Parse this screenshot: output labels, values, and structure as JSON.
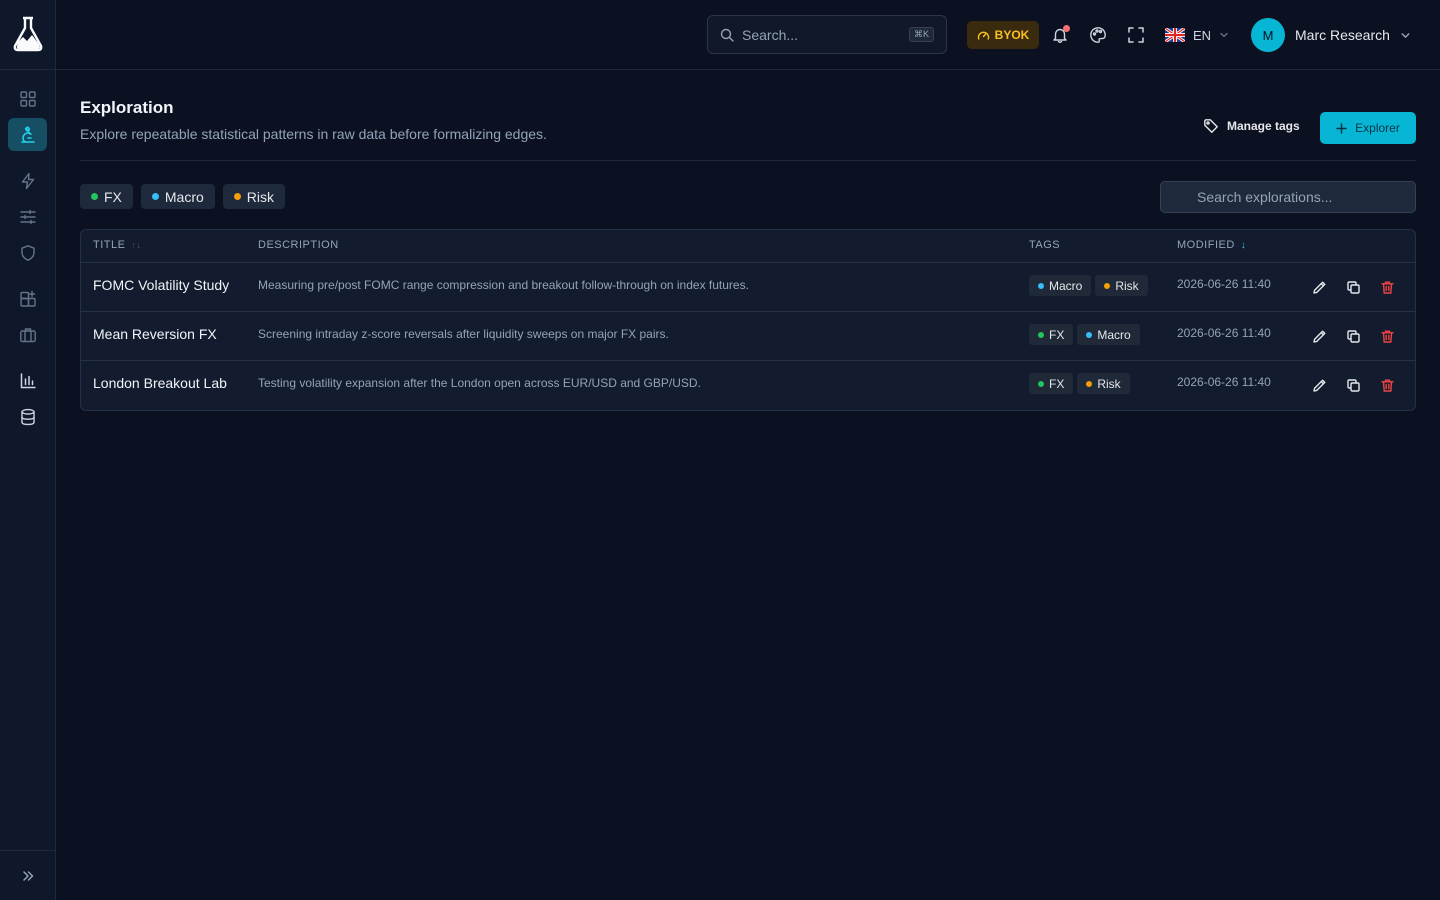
{
  "topbar": {
    "search_placeholder": "Search...",
    "search_shortcut": "⌘K",
    "byok_label": "BYOK",
    "language": "EN",
    "user": {
      "initial": "M",
      "name": "Marc Research"
    }
  },
  "sidebar": {
    "items": [
      {
        "icon": "dashboard-icon",
        "active": false
      },
      {
        "icon": "microscope-icon",
        "active": true
      },
      {
        "icon": "lightning-icon",
        "active": false
      },
      {
        "icon": "sliders-icon",
        "active": false
      },
      {
        "icon": "shield-icon",
        "active": false
      },
      {
        "icon": "apps-add-icon",
        "active": false
      },
      {
        "icon": "briefcase-icon",
        "active": false
      },
      {
        "icon": "bar-chart-icon",
        "active": false
      },
      {
        "icon": "database-icon",
        "active": false
      }
    ]
  },
  "page": {
    "title": "Exploration",
    "subtitle": "Explore repeatable statistical patterns in raw data before formalizing edges.",
    "manage_tags_label": "Manage tags",
    "explorer_button_label": "Explorer",
    "search_explorations_placeholder": "Search explorations..."
  },
  "colors": {
    "accent": "#06b6d4",
    "fx": "#22c55e",
    "macro": "#38bdf8",
    "risk": "#f59e0b",
    "delete": "#ef4444"
  },
  "filters": [
    {
      "label": "FX",
      "color": "#22c55e"
    },
    {
      "label": "Macro",
      "color": "#38bdf8"
    },
    {
      "label": "Risk",
      "color": "#f59e0b"
    }
  ],
  "table": {
    "columns": {
      "title": "TITLE",
      "title_sort": "↑↓",
      "description": "DESCRIPTION",
      "tags": "TAGS",
      "modified": "MODIFIED",
      "modified_sort": "↓"
    },
    "rows": [
      {
        "title": "FOMC Volatility Study",
        "description": "Measuring pre/post FOMC range compression and breakout follow-through on index futures.",
        "tags": [
          {
            "label": "Macro",
            "color": "#38bdf8"
          },
          {
            "label": "Risk",
            "color": "#f59e0b"
          }
        ],
        "modified": "2026-06-26 11:40"
      },
      {
        "title": "Mean Reversion FX",
        "description": "Screening intraday z-score reversals after liquidity sweeps on major FX pairs.",
        "tags": [
          {
            "label": "FX",
            "color": "#22c55e"
          },
          {
            "label": "Macro",
            "color": "#38bdf8"
          }
        ],
        "modified": "2026-06-26 11:40"
      },
      {
        "title": "London Breakout Lab",
        "description": "Testing volatility expansion after the London open across EUR/USD and GBP/USD.",
        "tags": [
          {
            "label": "FX",
            "color": "#22c55e"
          },
          {
            "label": "Risk",
            "color": "#f59e0b"
          }
        ],
        "modified": "2026-06-26 11:40"
      }
    ]
  }
}
